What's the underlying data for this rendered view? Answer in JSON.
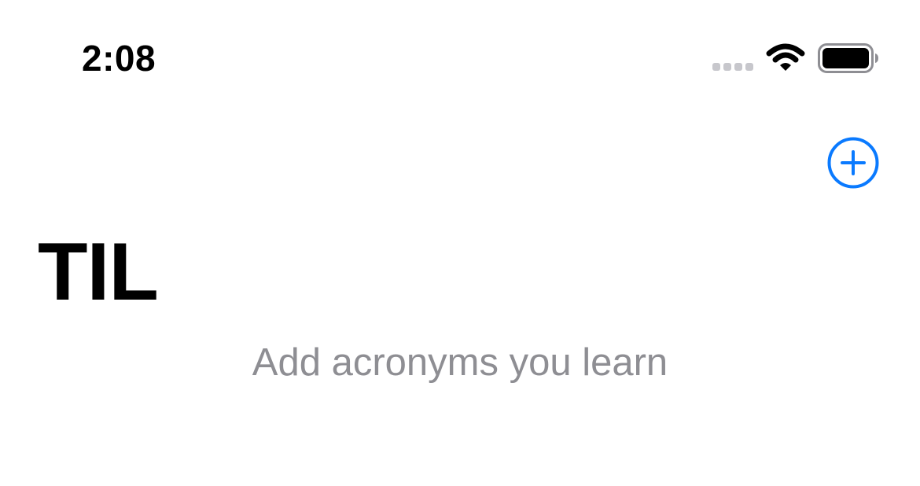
{
  "status_bar": {
    "time": "2:08",
    "signal_icon": "cellular-signal-icon",
    "wifi_icon": "wifi-icon",
    "battery_icon": "battery-icon",
    "battery_level": 1.0
  },
  "navigation": {
    "title": "TIL",
    "add_button_icon": "plus-circle-icon",
    "accent_color": "#0a7aff"
  },
  "content": {
    "empty_message": "Add acronyms you learn"
  }
}
